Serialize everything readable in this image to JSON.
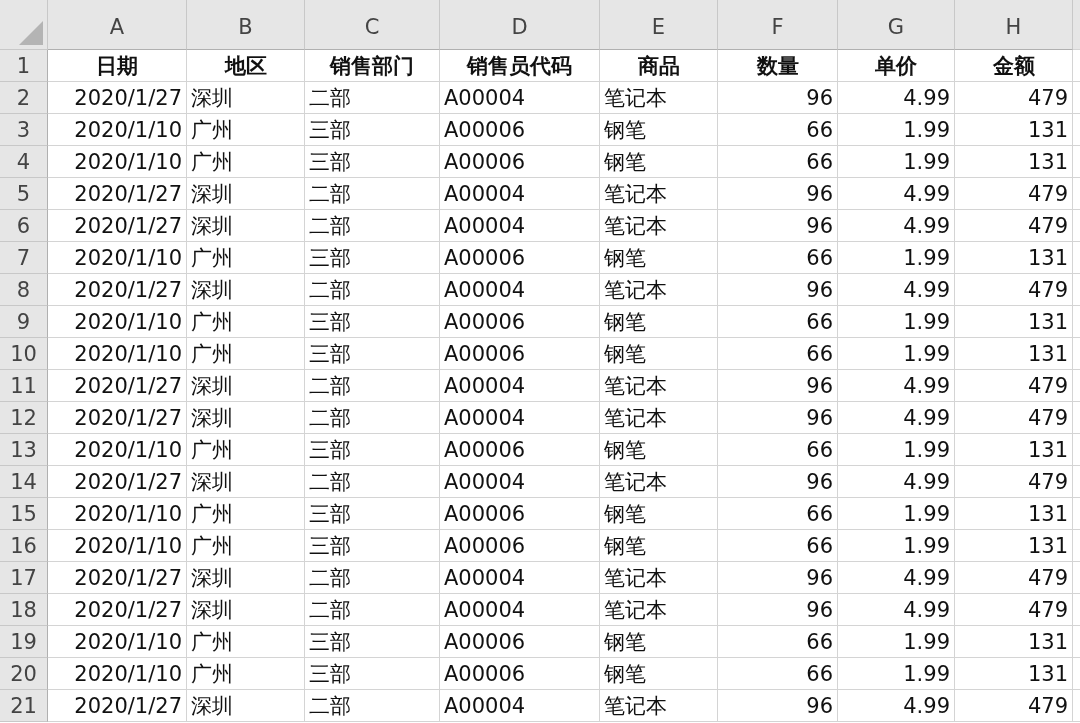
{
  "columns": [
    "A",
    "B",
    "C",
    "D",
    "E",
    "F",
    "G",
    "H"
  ],
  "header_row": {
    "number": "1",
    "cells": [
      "日期",
      "地区",
      "销售部门",
      "销售员代码",
      "商品",
      "数量",
      "单价",
      "金额"
    ]
  },
  "rows": [
    {
      "number": "2",
      "cells": [
        "2020/1/27",
        "深圳",
        "二部",
        "A00004",
        "笔记本",
        "96",
        "4.99",
        "479"
      ]
    },
    {
      "number": "3",
      "cells": [
        "2020/1/10",
        "广州",
        "三部",
        "A00006",
        "钢笔",
        "66",
        "1.99",
        "131"
      ]
    },
    {
      "number": "4",
      "cells": [
        "2020/1/10",
        "广州",
        "三部",
        "A00006",
        "钢笔",
        "66",
        "1.99",
        "131"
      ]
    },
    {
      "number": "5",
      "cells": [
        "2020/1/27",
        "深圳",
        "二部",
        "A00004",
        "笔记本",
        "96",
        "4.99",
        "479"
      ]
    },
    {
      "number": "6",
      "cells": [
        "2020/1/27",
        "深圳",
        "二部",
        "A00004",
        "笔记本",
        "96",
        "4.99",
        "479"
      ]
    },
    {
      "number": "7",
      "cells": [
        "2020/1/10",
        "广州",
        "三部",
        "A00006",
        "钢笔",
        "66",
        "1.99",
        "131"
      ]
    },
    {
      "number": "8",
      "cells": [
        "2020/1/27",
        "深圳",
        "二部",
        "A00004",
        "笔记本",
        "96",
        "4.99",
        "479"
      ]
    },
    {
      "number": "9",
      "cells": [
        "2020/1/10",
        "广州",
        "三部",
        "A00006",
        "钢笔",
        "66",
        "1.99",
        "131"
      ]
    },
    {
      "number": "10",
      "cells": [
        "2020/1/10",
        "广州",
        "三部",
        "A00006",
        "钢笔",
        "66",
        "1.99",
        "131"
      ]
    },
    {
      "number": "11",
      "cells": [
        "2020/1/27",
        "深圳",
        "二部",
        "A00004",
        "笔记本",
        "96",
        "4.99",
        "479"
      ]
    },
    {
      "number": "12",
      "cells": [
        "2020/1/27",
        "深圳",
        "二部",
        "A00004",
        "笔记本",
        "96",
        "4.99",
        "479"
      ]
    },
    {
      "number": "13",
      "cells": [
        "2020/1/10",
        "广州",
        "三部",
        "A00006",
        "钢笔",
        "66",
        "1.99",
        "131"
      ]
    },
    {
      "number": "14",
      "cells": [
        "2020/1/27",
        "深圳",
        "二部",
        "A00004",
        "笔记本",
        "96",
        "4.99",
        "479"
      ]
    },
    {
      "number": "15",
      "cells": [
        "2020/1/10",
        "广州",
        "三部",
        "A00006",
        "钢笔",
        "66",
        "1.99",
        "131"
      ]
    },
    {
      "number": "16",
      "cells": [
        "2020/1/10",
        "广州",
        "三部",
        "A00006",
        "钢笔",
        "66",
        "1.99",
        "131"
      ]
    },
    {
      "number": "17",
      "cells": [
        "2020/1/27",
        "深圳",
        "二部",
        "A00004",
        "笔记本",
        "96",
        "4.99",
        "479"
      ]
    },
    {
      "number": "18",
      "cells": [
        "2020/1/27",
        "深圳",
        "二部",
        "A00004",
        "笔记本",
        "96",
        "4.99",
        "479"
      ]
    },
    {
      "number": "19",
      "cells": [
        "2020/1/10",
        "广州",
        "三部",
        "A00006",
        "钢笔",
        "66",
        "1.99",
        "131"
      ]
    },
    {
      "number": "20",
      "cells": [
        "2020/1/10",
        "广州",
        "三部",
        "A00006",
        "钢笔",
        "66",
        "1.99",
        "131"
      ]
    },
    {
      "number": "21",
      "cells": [
        "2020/1/27",
        "深圳",
        "二部",
        "A00004",
        "笔记本",
        "96",
        "4.99",
        "479"
      ]
    }
  ]
}
